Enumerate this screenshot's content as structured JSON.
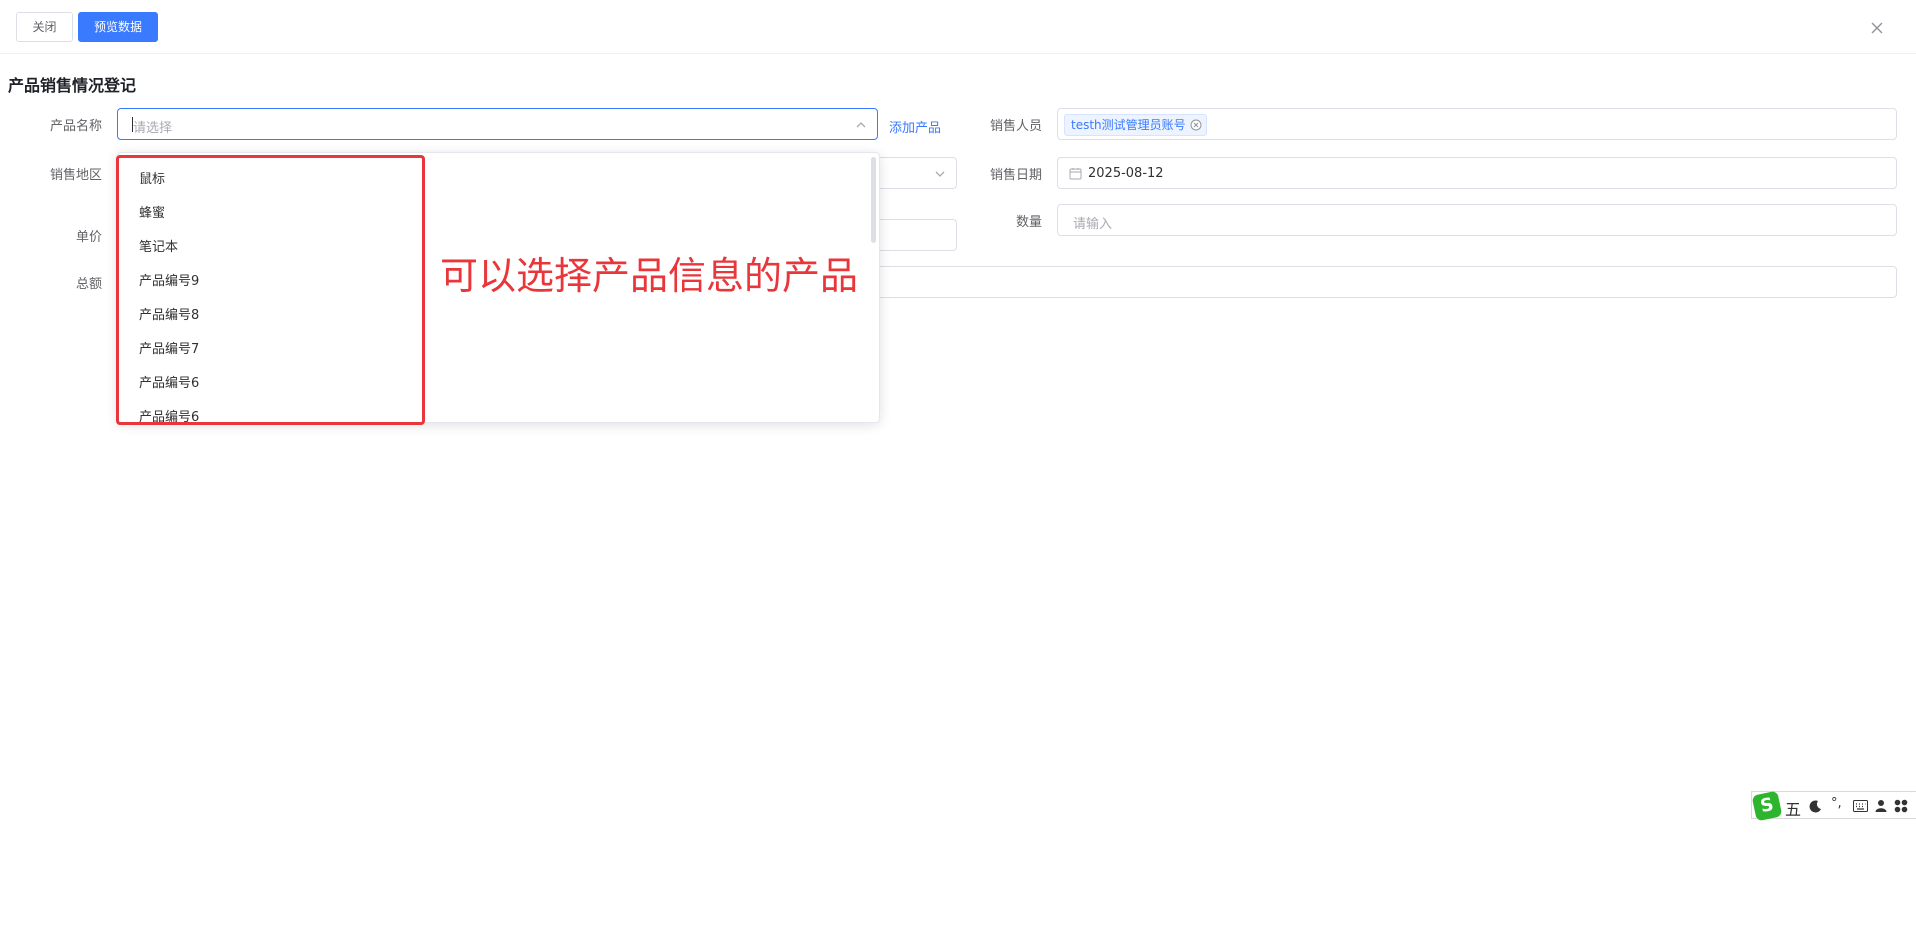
{
  "toolbar": {
    "close_label": "关闭",
    "preview_label": "预览数据"
  },
  "form": {
    "title": "产品销售情况登记",
    "product_name": {
      "label": "产品名称",
      "placeholder": "请选择",
      "add_link": "添加产品"
    },
    "salesperson": {
      "label": "销售人员",
      "tag": "testh测试管理员账号"
    },
    "region": {
      "label": "销售地区"
    },
    "sale_date": {
      "label": "销售日期",
      "value": "2025-08-12"
    },
    "unit_price": {
      "label": "单价"
    },
    "quantity": {
      "label": "数量",
      "placeholder": "请输入"
    },
    "total": {
      "label": "总额"
    }
  },
  "dropdown": {
    "items": [
      "鼠标",
      "蜂蜜",
      "笔记本",
      "产品编号9",
      "产品编号8",
      "产品编号7",
      "产品编号6",
      "产品编号6"
    ]
  },
  "annotation": {
    "text": "可以选择产品信息的产品",
    "color": "#e8363a"
  },
  "ime": {
    "logo": "S",
    "mode": "五",
    "punct": "°,"
  },
  "colors": {
    "primary": "#3a7afe"
  }
}
